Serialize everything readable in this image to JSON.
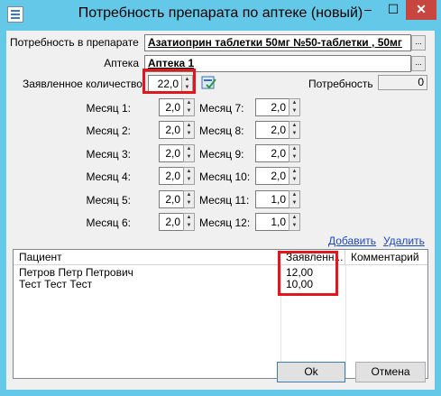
{
  "window": {
    "title": "Потребность препарата по аптеке (новый)"
  },
  "titlebar": {
    "minimize_glyph": "–",
    "maximize_glyph": "☐",
    "close_glyph": "✕"
  },
  "form": {
    "preparation_label": "Потребность в препарате",
    "preparation_value": "Азатиоприн таблетки  50мг №50-таблетки , 50мг",
    "pharmacy_label": "Аптека",
    "pharmacy_value": "Аптека 1",
    "declared_label": "Заявленное количество",
    "declared_value": "22,0",
    "need_label": "Потребность",
    "need_value": "0",
    "lookup_glyph": "...",
    "spin_up": "▲",
    "spin_down": "▼"
  },
  "months": [
    {
      "label": "Месяц 1:",
      "value": "2,0"
    },
    {
      "label": "Месяц 2:",
      "value": "2,0"
    },
    {
      "label": "Месяц 3:",
      "value": "2,0"
    },
    {
      "label": "Месяц 4:",
      "value": "2,0"
    },
    {
      "label": "Месяц 5:",
      "value": "2,0"
    },
    {
      "label": "Месяц 6:",
      "value": "2,0"
    },
    {
      "label": "Месяц 7:",
      "value": "2,0"
    },
    {
      "label": "Месяц 8:",
      "value": "2,0"
    },
    {
      "label": "Месяц 9:",
      "value": "2,0"
    },
    {
      "label": "Месяц 10:",
      "value": "2,0"
    },
    {
      "label": "Месяц 11:",
      "value": "1,0"
    },
    {
      "label": "Месяц 12:",
      "value": "1,0"
    }
  ],
  "links": {
    "add": "Добавить",
    "delete": "Удалить"
  },
  "table": {
    "columns": [
      "Пациент",
      "Заявленн...",
      "Комментарий"
    ],
    "rows": [
      {
        "patient": "Петров Петр Петрович",
        "declared": "12,00",
        "comment": ""
      },
      {
        "patient": "Тест Тест Тест",
        "declared": "10,00",
        "comment": ""
      }
    ]
  },
  "buttons": {
    "ok": "Ok",
    "cancel": "Отмена"
  },
  "colors": {
    "title_bar": "#64c8e8",
    "close_button": "#c7463f",
    "highlight": "#e0181b",
    "link": "#1a46c8"
  }
}
